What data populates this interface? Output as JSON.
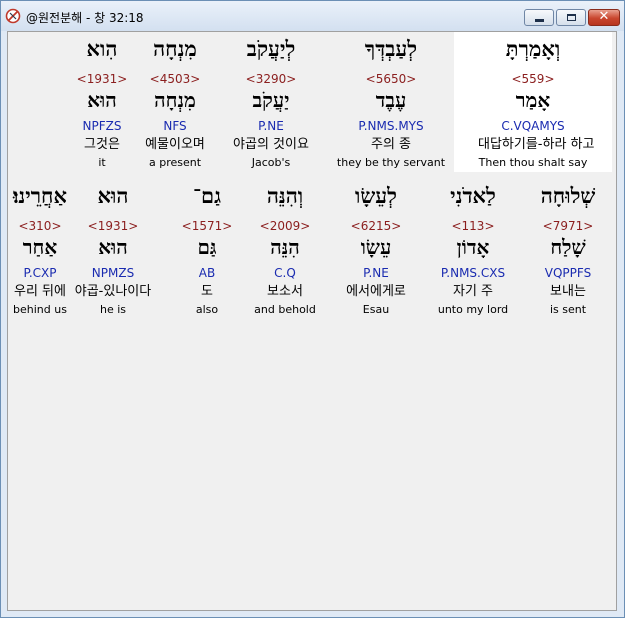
{
  "window": {
    "title": "@원전분해 - 창 32:18",
    "close_glyph": "✕"
  },
  "rows": [
    [
      {
        "hebrew": "וְאָמַרְתָּ",
        "strong": "<559>",
        "lemma": "אָמַר",
        "parse": "C.VQAMYS",
        "korean": "대답하기를-하라 하고",
        "english": "Then thou shalt say",
        "highlighted": true
      },
      {
        "hebrew": "לְעַבְדְּךָ",
        "strong": "<5650>",
        "lemma": "עֶבֶד",
        "parse": "P.NMS.MYS",
        "korean": "주의 종",
        "english": "they be thy servant"
      },
      {
        "hebrew": "לְיַעֲקֹב",
        "strong": "<3290>",
        "lemma": "יַעֲקֹב",
        "parse": "P.NE",
        "korean": "야곱의 것이요",
        "english": "Jacob's"
      },
      {
        "hebrew": "מִנְחָה",
        "strong": "<4503>",
        "lemma": "מִנְחָה",
        "parse": "NFS",
        "korean": "예물이오며",
        "english": "a present"
      },
      {
        "hebrew": "הִוא",
        "strong": "<1931>",
        "lemma": "הוּא",
        "parse": "NPFZS",
        "korean": "그것은",
        "english": "it"
      }
    ],
    [
      {
        "hebrew": "שְׁלוּחָה",
        "strong": "<7971>",
        "lemma": "שָׁלַח",
        "parse": "VQPPFS",
        "korean": "보내는",
        "english": "is sent"
      },
      {
        "hebrew": "לַאדֹנִי",
        "strong": "<113>",
        "lemma": "אָדוֹן",
        "parse": "P.NMS.CXS",
        "korean": "자기 주",
        "english": "unto my lord"
      },
      {
        "hebrew": "לְעֵשָׂו",
        "strong": "<6215>",
        "lemma": "עֵשָׂו",
        "parse": "P.NE",
        "korean": "에서에게로",
        "english": "Esau"
      },
      {
        "hebrew": "וְהִנֵּה",
        "strong": "<2009>",
        "lemma": "הִנֵּה",
        "parse": "C.Q",
        "korean": "보소서",
        "english": "and behold"
      },
      {
        "hebrew": "גַם־",
        "strong": "<1571>",
        "lemma": "גַּם",
        "parse": "AB",
        "korean": "도",
        "english": "also"
      },
      {
        "hebrew": "הוּא",
        "strong": "<1931>",
        "lemma": "הוּא",
        "parse": "NPMZS",
        "korean": "야곱-있나이다",
        "english": "he is"
      },
      {
        "hebrew": "אַחֲרֵינוּ׃",
        "strong": "<310>",
        "lemma": "אַחַר",
        "parse": "P.CXP",
        "korean": "우리 뒤에",
        "english": "behind us"
      }
    ]
  ]
}
